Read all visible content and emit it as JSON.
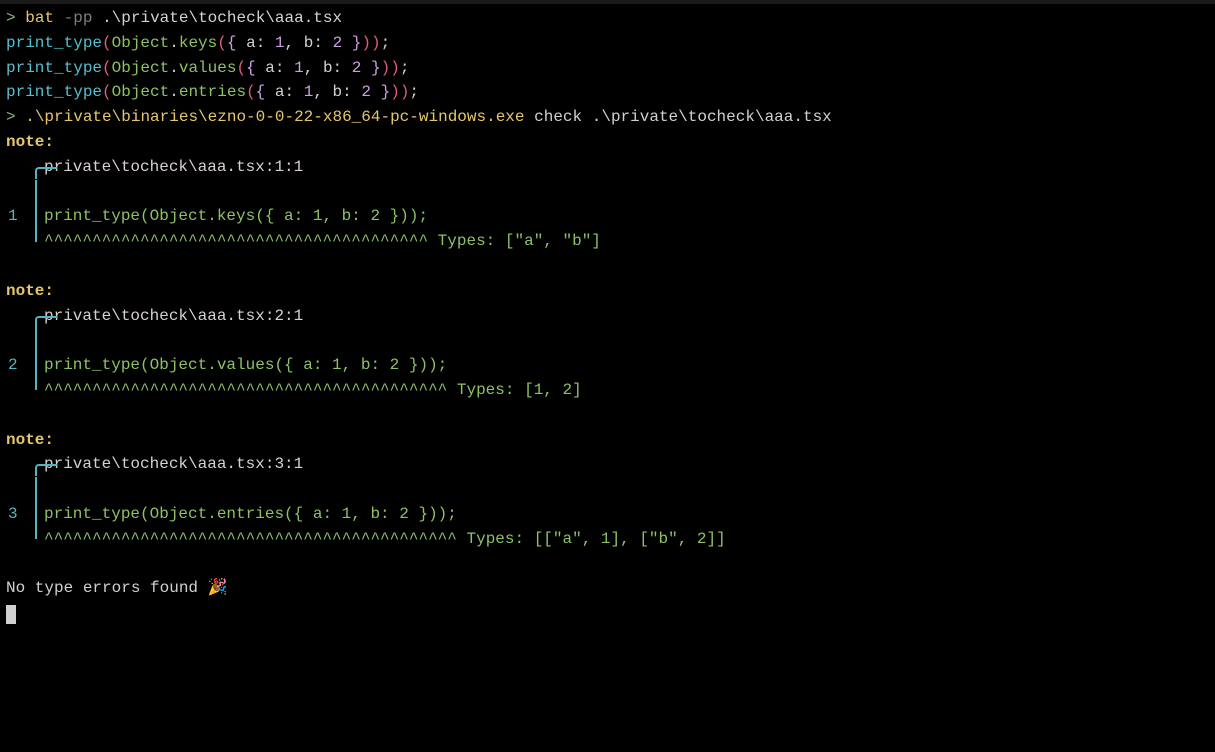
{
  "cmd1": {
    "prompt": ">",
    "bat": "bat",
    "flag": "-pp",
    "path": ".\\private\\tocheck\\aaa.tsx"
  },
  "source": {
    "l1": {
      "fn": "print_type",
      "obj": "Object",
      "method": "keys",
      "ka": "a",
      "va": "1",
      "kb": "b",
      "vb": "2"
    },
    "l2": {
      "fn": "print_type",
      "obj": "Object",
      "method": "values",
      "ka": "a",
      "va": "1",
      "kb": "b",
      "vb": "2"
    },
    "l3": {
      "fn": "print_type",
      "obj": "Object",
      "method": "entries",
      "ka": "a",
      "va": "1",
      "kb": "b",
      "vb": "2"
    }
  },
  "cmd2": {
    "prompt": ">",
    "exe": ".\\private\\binaries\\ezno-0-0-22-x86_64-pc-windows.exe",
    "sub": "check",
    "path": ".\\private\\tocheck\\aaa.tsx"
  },
  "notes": [
    {
      "label": "note:",
      "loc": "private\\tocheck\\aaa.tsx:1:1",
      "linenum": "1",
      "code": "print_type(Object.keys({ a: 1, b: 2 }));",
      "carets": "^^^^^^^^^^^^^^^^^^^^^^^^^^^^^^^^^^^^^^^^",
      "types_label": "Types:",
      "types_val": "[\"a\", \"b\"]"
    },
    {
      "label": "note:",
      "loc": "private\\tocheck\\aaa.tsx:2:1",
      "linenum": "2",
      "code": "print_type(Object.values({ a: 1, b: 2 }));",
      "carets": "^^^^^^^^^^^^^^^^^^^^^^^^^^^^^^^^^^^^^^^^^^",
      "types_label": "Types:",
      "types_val": "[1, 2]"
    },
    {
      "label": "note:",
      "loc": "private\\tocheck\\aaa.tsx:3:1",
      "linenum": "3",
      "code": "print_type(Object.entries({ a: 1, b: 2 }));",
      "carets": "^^^^^^^^^^^^^^^^^^^^^^^^^^^^^^^^^^^^^^^^^^^",
      "types_label": "Types:",
      "types_val": "[[\"a\", 1], [\"b\", 2]]"
    }
  ],
  "footer": {
    "text": "No type errors found ",
    "emoji": "🎉"
  }
}
